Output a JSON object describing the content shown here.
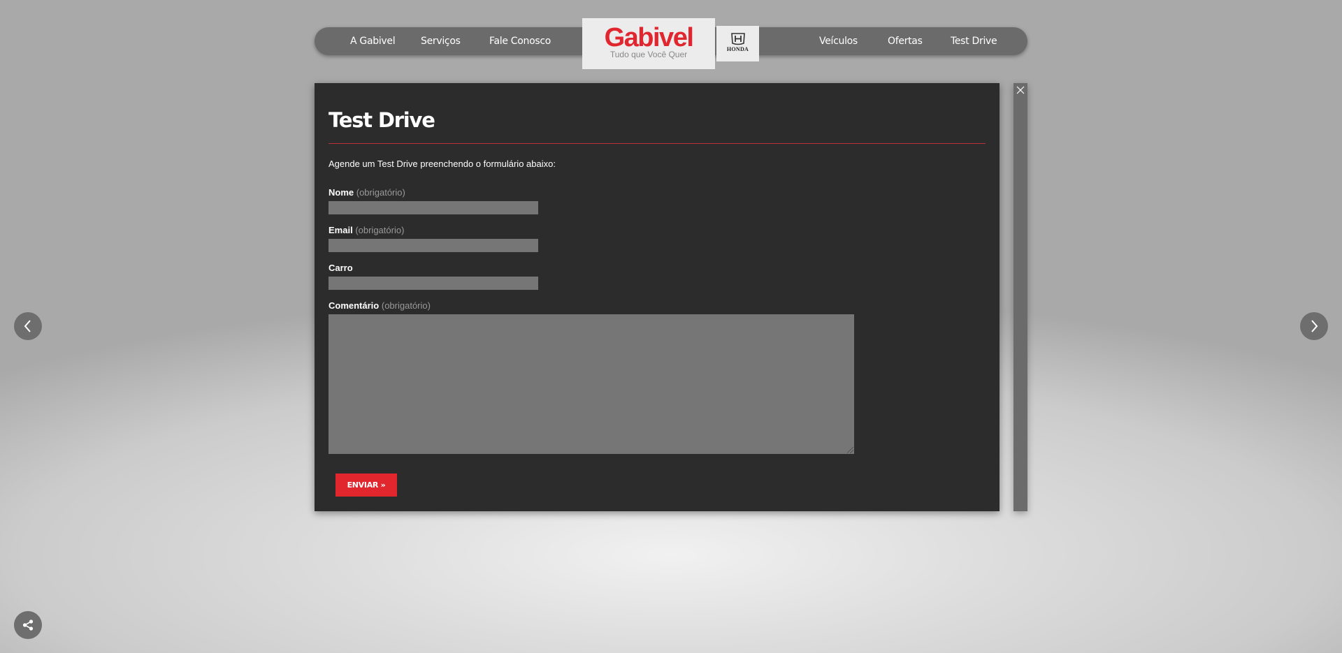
{
  "nav": {
    "left": [
      {
        "label": "A Gabivel"
      },
      {
        "label": "Serviços"
      },
      {
        "label": "Fale Conosco"
      }
    ],
    "right": [
      {
        "label": "Veículos"
      },
      {
        "label": "Ofertas"
      },
      {
        "label": "Test Drive"
      }
    ]
  },
  "logo": {
    "name": "Gabivel",
    "tagline": "Tudo que Você Quer"
  },
  "brand": {
    "name": "HONDA"
  },
  "form": {
    "title": "Test Drive",
    "intro": "Agende um Test Drive preenchendo o formulário abaixo:",
    "fields": [
      {
        "label": "Nome",
        "note": "(obrigatório)",
        "value": ""
      },
      {
        "label": "Email",
        "note": "(obrigatório)",
        "value": ""
      },
      {
        "label": "Carro",
        "note": "",
        "value": ""
      }
    ],
    "comment": {
      "label": "Comentário",
      "note": "(obrigatório)",
      "value": ""
    },
    "submit_label": "ENVIAR »"
  },
  "colors": {
    "accent": "#e1262e",
    "panel": "#2c2c2c",
    "nav_bar": "#6b6b6b",
    "input": "#767676"
  },
  "icons": {
    "close": "close-icon",
    "prev": "chevron-left-icon",
    "next": "chevron-right-icon",
    "share": "share-icon",
    "brand": "honda-logo-icon"
  }
}
